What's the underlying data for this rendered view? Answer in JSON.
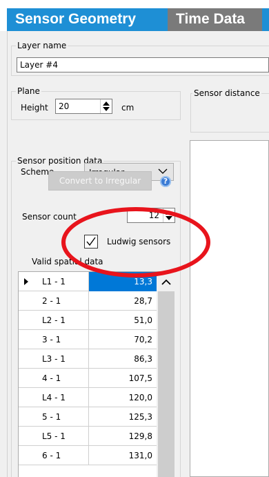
{
  "tabs": [
    {
      "label": "Sensor Geometry",
      "active": true
    },
    {
      "label": "Time Data",
      "active": false
    }
  ],
  "layer": {
    "legend": "Layer name",
    "value": "Layer #4"
  },
  "plane": {
    "legend": "Plane",
    "height_label": "Height",
    "height_value": "20",
    "unit": "cm"
  },
  "sensor_distance": {
    "legend": "Sensor distance"
  },
  "sensor_position": {
    "legend": "Sensor position data",
    "scheme_label": "Scheme",
    "scheme_value": "Irregular",
    "convert_button": "Convert to Irregular",
    "help_icon": "help-icon",
    "count_label": "Sensor count",
    "count_value": "12",
    "ludwig_label": "Ludwig sensors",
    "ludwig_checked": true,
    "valid_label": "Valid spatial data"
  },
  "table": {
    "rows": [
      {
        "name": "L1 - 1",
        "value": "13,3",
        "selected": true
      },
      {
        "name": "2 - 1",
        "value": "28,7"
      },
      {
        "name": "L2 - 1",
        "value": "51,0"
      },
      {
        "name": "3 - 1",
        "value": "70,2"
      },
      {
        "name": "L3 - 1",
        "value": "86,3"
      },
      {
        "name": "4 - 1",
        "value": "107,5"
      },
      {
        "name": "L4 - 1",
        "value": "120,0"
      },
      {
        "name": "5 - 1",
        "value": "125,3"
      },
      {
        "name": "L5 - 1",
        "value": "129,8"
      },
      {
        "name": "6 - 1",
        "value": "131,0"
      }
    ]
  },
  "colors": {
    "tab_active": "#1E8FD5",
    "tab_inactive": "#7A7A7A",
    "selection": "#0078D7",
    "annotation": "#E8141C"
  }
}
